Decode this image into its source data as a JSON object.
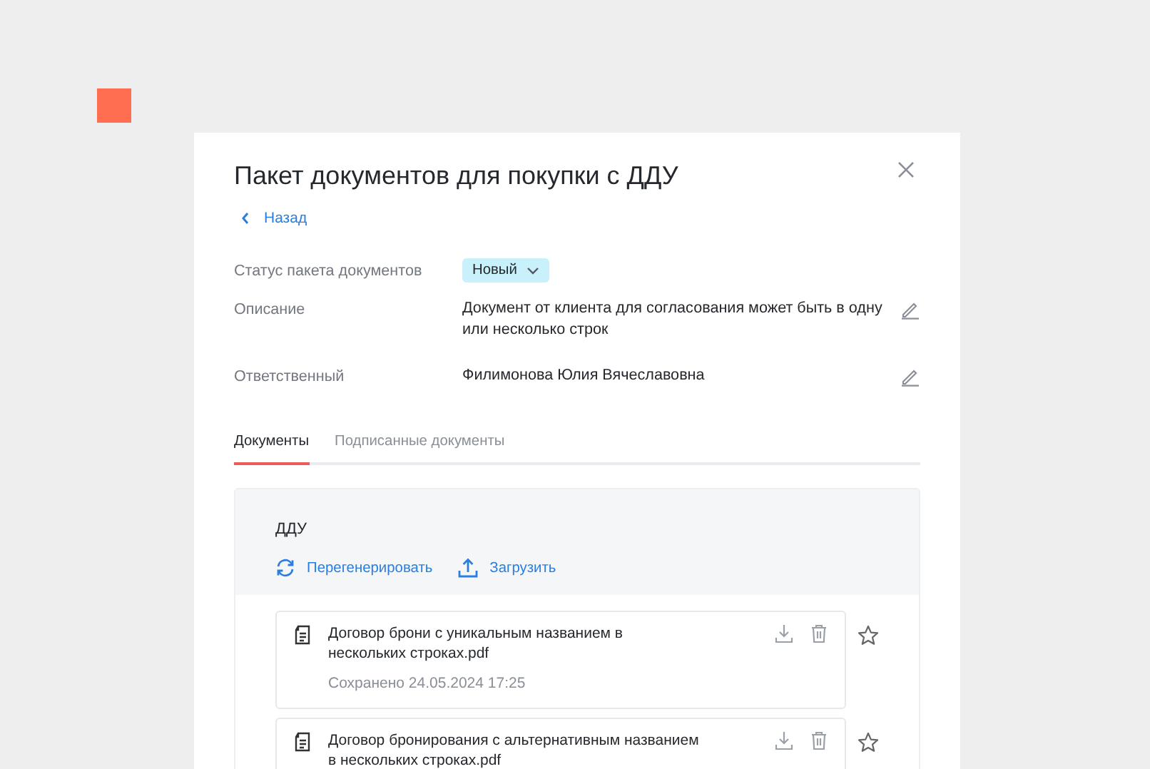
{
  "dialog": {
    "title": "Пакет документов для покупки с ДДУ",
    "back_link": "Назад"
  },
  "fields": [
    {
      "kind": "status",
      "label": "Статус пакета документов",
      "value": "Новый"
    },
    {
      "kind": "text",
      "label": "Описание",
      "value": "Документ от клиента для согласования может быть в одну или несколько строк"
    },
    {
      "kind": "text",
      "label": "Ответственный",
      "value": "Филимонова Юлия Вячеславовна"
    }
  ],
  "tabs": [
    {
      "label": "Документы",
      "selected": true
    },
    {
      "label": "Подписанные документы",
      "selected": false
    }
  ],
  "section": {
    "title": "ДДУ",
    "actions": [
      {
        "kind": "regenerate",
        "label": "Перегенерировать"
      },
      {
        "kind": "upload",
        "label": "Загрузить"
      }
    ]
  },
  "documents": [
    {
      "name": "Договор брони с уникальным названием в нескольких строках.pdf",
      "saved": "Сохранено 24.05.2024 17:25"
    },
    {
      "name": "Договор бронирования с альтернативным названием в нескольких строках.pdf"
    }
  ]
}
